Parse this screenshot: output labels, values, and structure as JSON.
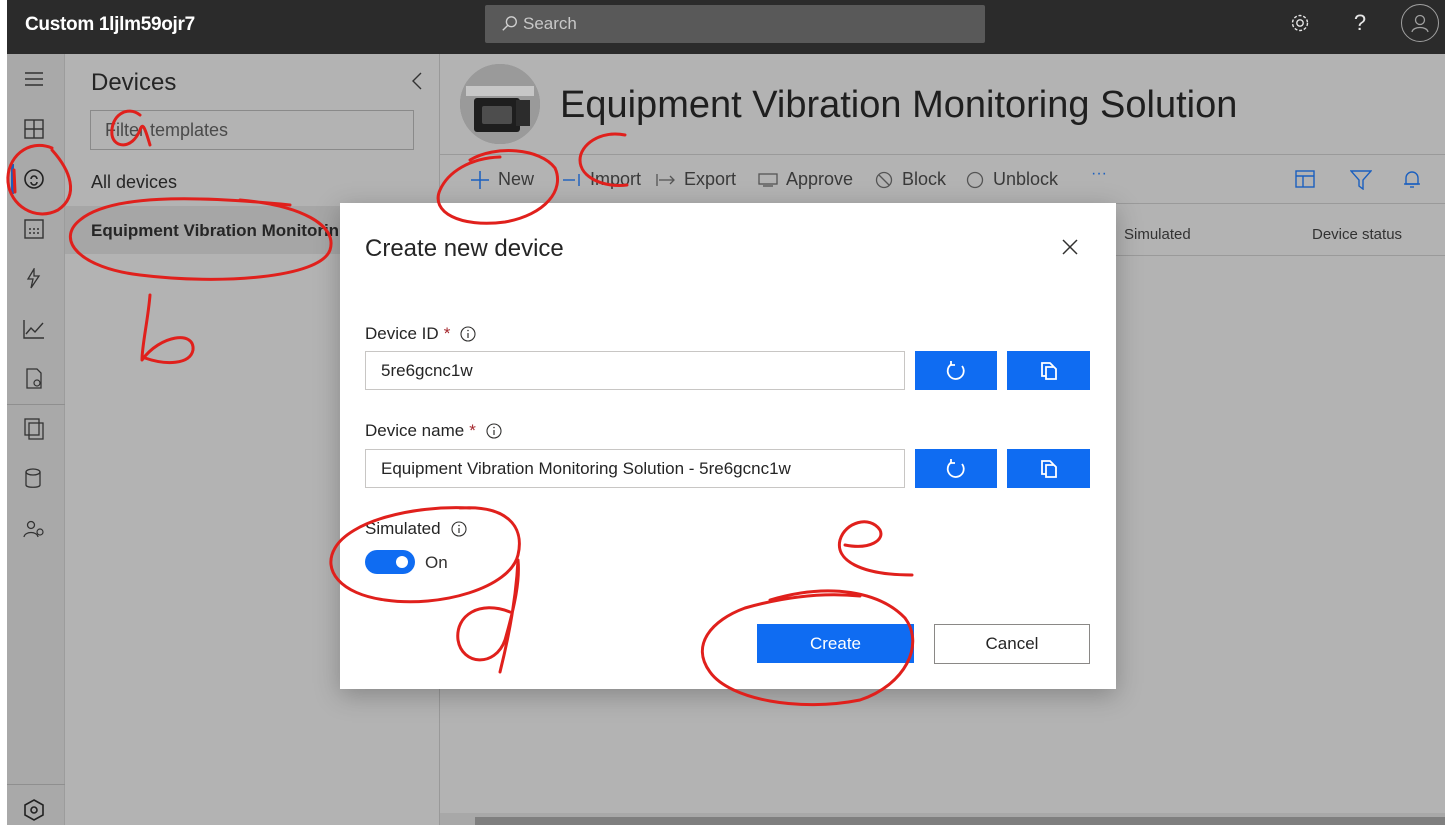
{
  "topbar": {
    "app_title": "Custom 1ljlm59ojr7",
    "search_placeholder": "Search"
  },
  "sidebar": {
    "items": [
      {
        "icon": "hamburger-icon"
      },
      {
        "icon": "dashboard-icon"
      },
      {
        "icon": "devices-icon",
        "active": true
      },
      {
        "icon": "device-groups-icon"
      },
      {
        "icon": "rules-icon"
      },
      {
        "icon": "analytics-icon"
      },
      {
        "icon": "jobs-icon"
      },
      {
        "icon": "device-templates-icon"
      },
      {
        "icon": "data-export-icon"
      },
      {
        "icon": "administration-icon"
      },
      {
        "icon": "iot-central-icon"
      }
    ]
  },
  "devices_panel": {
    "title": "Devices",
    "filter_placeholder": "Filter templates",
    "all_devices": "All devices",
    "template_item": "Equipment Vibration Monitorin"
  },
  "header": {
    "title": "Equipment Vibration Monitoring Solution"
  },
  "toolbar": {
    "new": "New",
    "import": "Import",
    "export": "Export",
    "approve": "Approve",
    "block": "Block",
    "unblock": "Unblock",
    "more": "···"
  },
  "grid": {
    "columns": [
      "Simulated",
      "Device status"
    ]
  },
  "modal": {
    "title": "Create new device",
    "device_id_label": "Device ID",
    "device_id_value": "5re6gcnc1w",
    "device_name_label": "Device name",
    "device_name_value": "Equipment Vibration Monitoring Solution - 5re6gcnc1w",
    "required_mark": "*",
    "simulated_label": "Simulated",
    "simulated_state": "On",
    "create_label": "Create",
    "cancel_label": "Cancel"
  },
  "annotations": {
    "color": "#e0201c",
    "labels": [
      "a",
      "b",
      "c",
      "d",
      "e"
    ]
  },
  "colors": {
    "primary": "#0f6cf2",
    "topbar": "#2b2b2b",
    "overlay": "#b3b3b3"
  }
}
